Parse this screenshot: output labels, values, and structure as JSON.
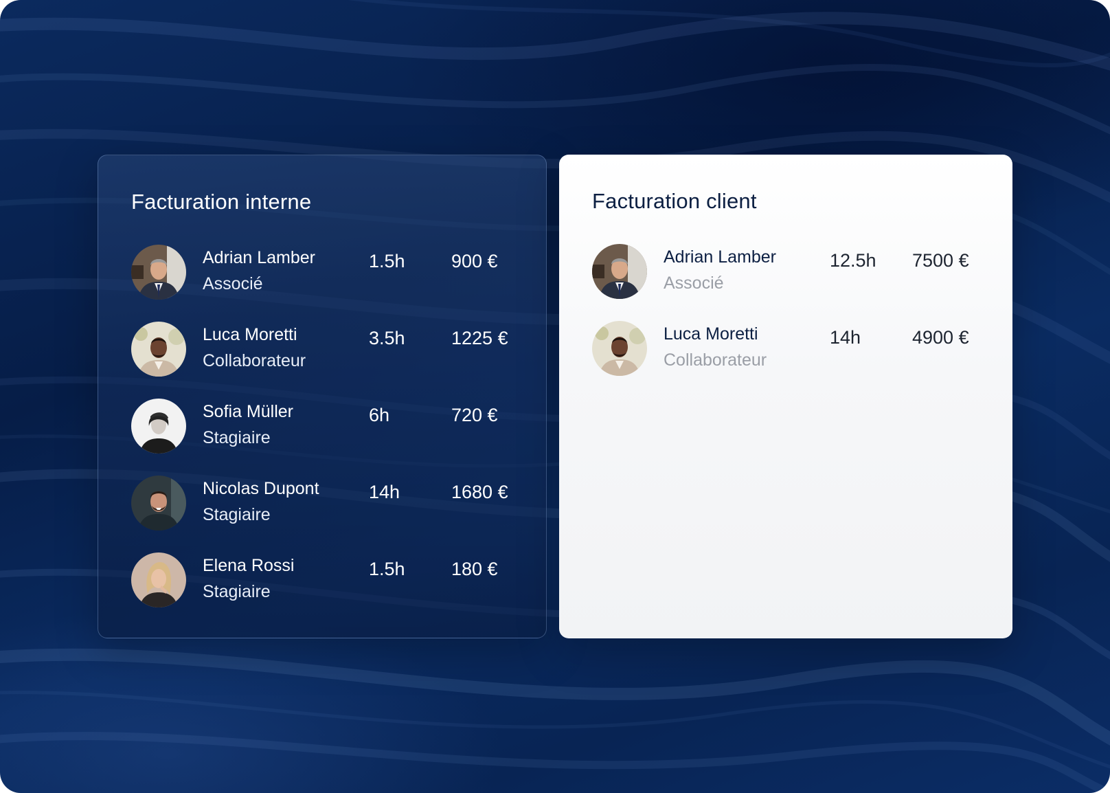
{
  "internal": {
    "title": "Facturation interne",
    "rows": [
      {
        "name": "Adrian Lamber",
        "role": "Associé",
        "hours": "1.5h",
        "amount": "900 €",
        "avatar": "avatar-photo-adrian"
      },
      {
        "name": "Luca Moretti",
        "role": "Collaborateur",
        "hours": "3.5h",
        "amount": "1225 €",
        "avatar": "avatar-photo-luca"
      },
      {
        "name": "Sofia Müller",
        "role": "Stagiaire",
        "hours": "6h",
        "amount": "720 €",
        "avatar": "avatar-photo-sofia"
      },
      {
        "name": "Nicolas Dupont",
        "role": "Stagiaire",
        "hours": "14h",
        "amount": "1680 €",
        "avatar": "avatar-photo-nicolas"
      },
      {
        "name": "Elena Rossi",
        "role": "Stagiaire",
        "hours": "1.5h",
        "amount": "180 €",
        "avatar": "avatar-photo-elena"
      }
    ]
  },
  "client": {
    "title": "Facturation client",
    "rows": [
      {
        "name": "Adrian Lamber",
        "role": "Associé",
        "hours": "12.5h",
        "amount": "7500 €",
        "avatar": "avatar-photo-adrian"
      },
      {
        "name": "Luca Moretti",
        "role": "Collaborateur",
        "hours": "14h",
        "amount": "4900 €",
        "avatar": "avatar-photo-luca"
      }
    ]
  },
  "colors": {
    "background": "#061d47",
    "client_title": "#0c1f42",
    "client_role": "#9a9ea6"
  }
}
